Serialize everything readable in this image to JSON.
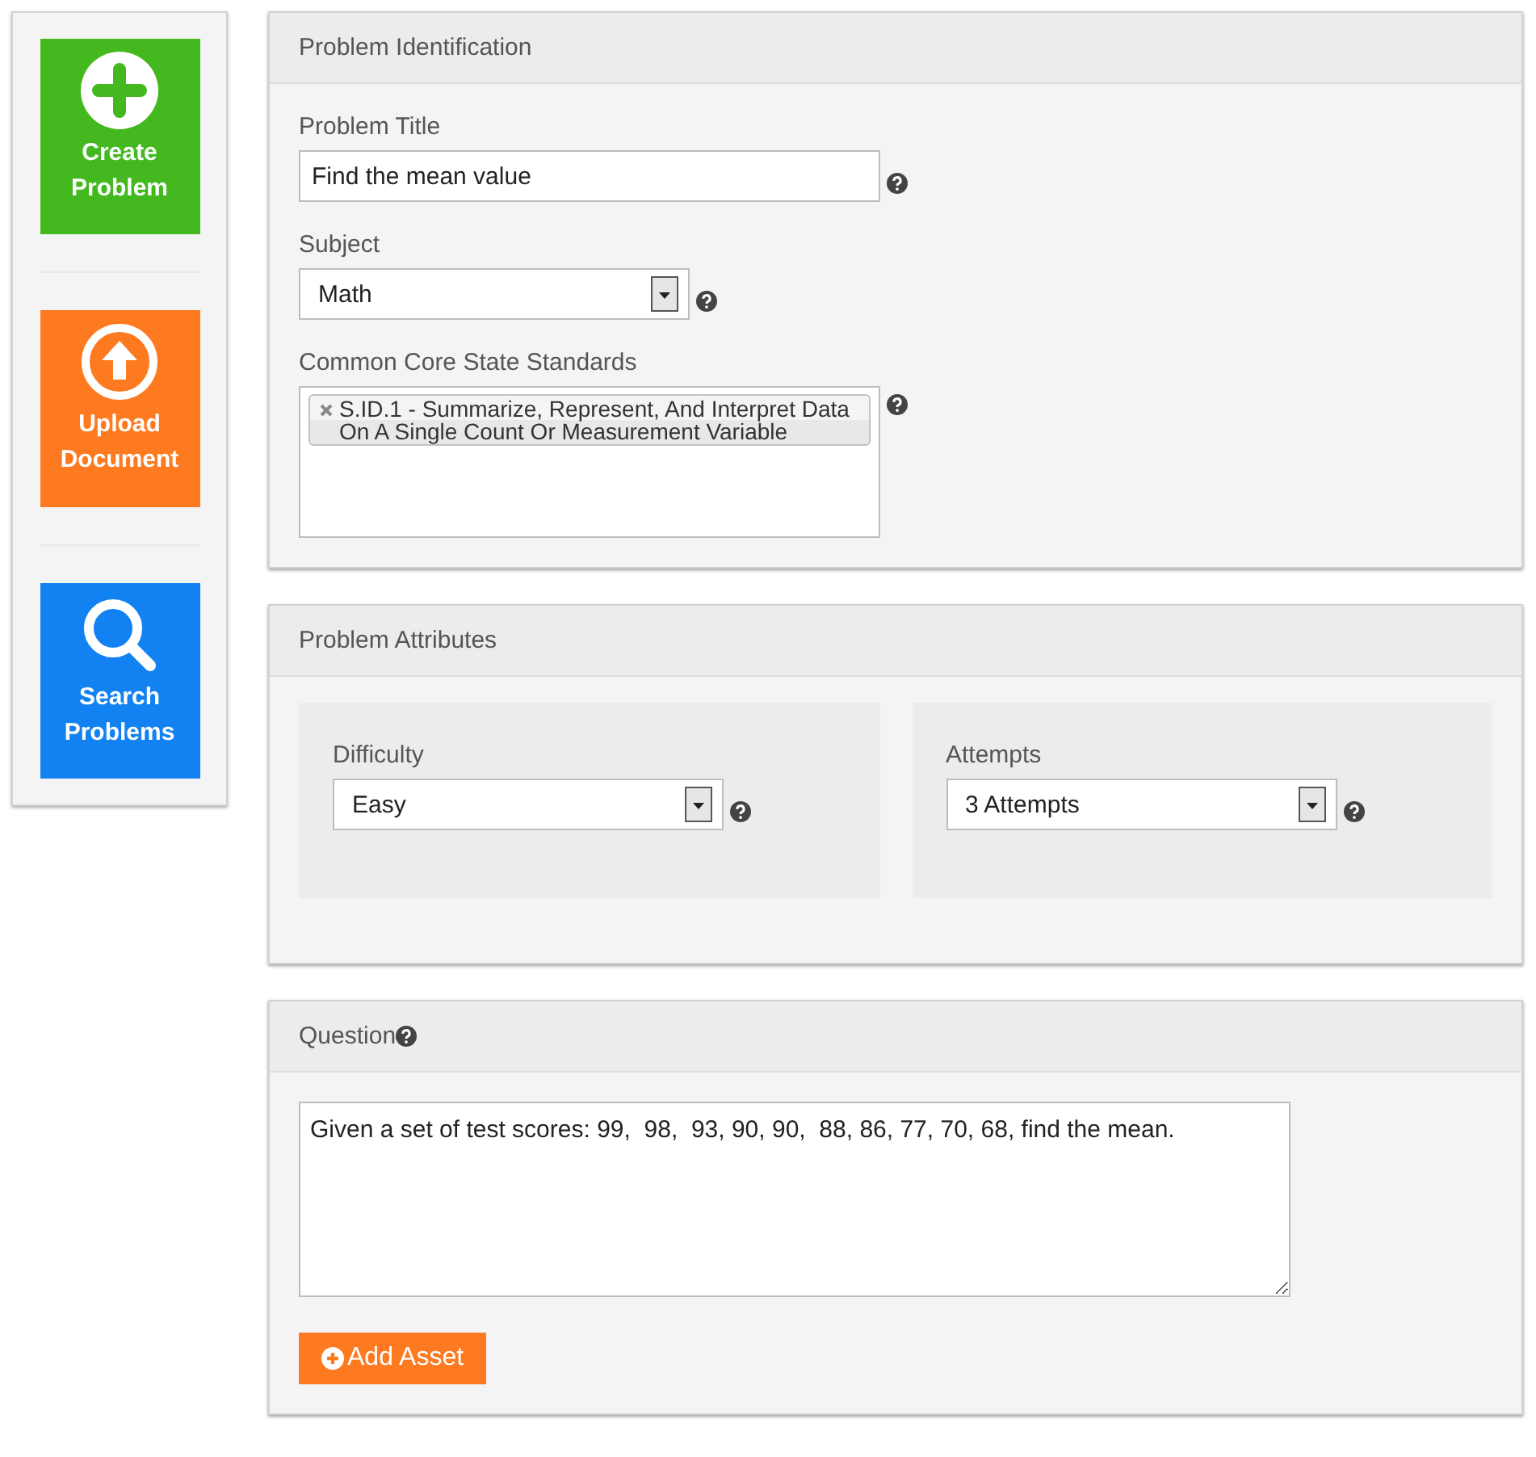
{
  "sidebar": {
    "items": [
      {
        "kind": "create",
        "label": "Create Problem",
        "color": "#43b91f"
      },
      {
        "kind": "upload",
        "label": "Upload Document",
        "color": "#fd7a20"
      },
      {
        "kind": "search",
        "label": "Search Problems",
        "color": "#1282f2"
      }
    ]
  },
  "identification": {
    "title": "Problem Identification",
    "problem_title": {
      "label": "Problem Title",
      "value": "Find the mean value"
    },
    "subject": {
      "label": "Subject",
      "value": "Math"
    },
    "standards": {
      "label": "Common Core State Standards",
      "tags": [
        "S.ID.1 - Summarize, Represent, And Interpret Data On A Single Count Or Measurement Variable"
      ]
    }
  },
  "attributes": {
    "title": "Problem Attributes",
    "fields": [
      {
        "label": "Difficulty",
        "value": "Easy"
      },
      {
        "label": "Attempts",
        "value": "3 Attempts"
      }
    ]
  },
  "question": {
    "title": "Question",
    "value": "Given a set of test scores: 99,  98,  93, 90, 90,  88, 86, 77, 70, 68, find the mean.",
    "button": "Add Asset"
  }
}
